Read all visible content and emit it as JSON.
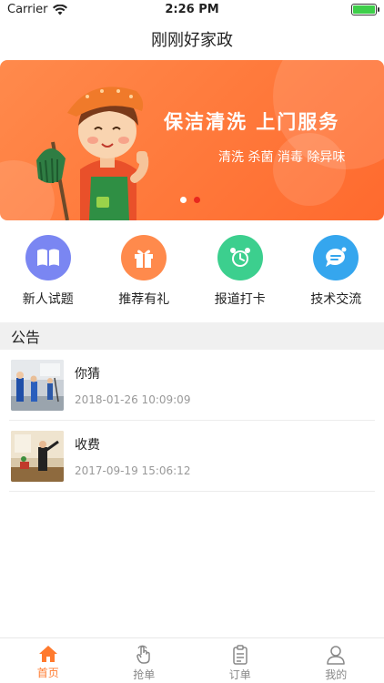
{
  "status_bar": {
    "carrier": "Carrier",
    "time": "2:26 PM",
    "battery_level": 1.0
  },
  "nav": {
    "title": "刚刚好家政"
  },
  "banner": {
    "headline": "保洁清洗  上门服务",
    "subline": "清洗 杀菌 消毒 除异味",
    "page_index": 1,
    "page_count": 2
  },
  "quick_menu": [
    {
      "label": "新人试题",
      "icon": "book-icon",
      "color": "#7a86f2"
    },
    {
      "label": "推荐有礼",
      "icon": "gift-icon",
      "color": "#ff8a4c"
    },
    {
      "label": "报道打卡",
      "icon": "alarm-clock-icon",
      "color": "#3ccf8e"
    },
    {
      "label": "技术交流",
      "icon": "chat-bubble-icon",
      "color": "#35a6ee"
    }
  ],
  "announcements": {
    "header": "公告",
    "items": [
      {
        "title": "你猜",
        "date": "2018-01-26 10:09:09"
      },
      {
        "title": "收费",
        "date": "2017-09-19 15:06:12"
      }
    ]
  },
  "tab_bar": {
    "active_color": "#ff7a2e",
    "tabs": [
      {
        "label": "首页",
        "icon": "home-icon",
        "active": true
      },
      {
        "label": "抢单",
        "icon": "tap-hand-icon",
        "active": false
      },
      {
        "label": "订单",
        "icon": "clipboard-icon",
        "active": false
      },
      {
        "label": "我的",
        "icon": "user-icon",
        "active": false
      }
    ]
  }
}
